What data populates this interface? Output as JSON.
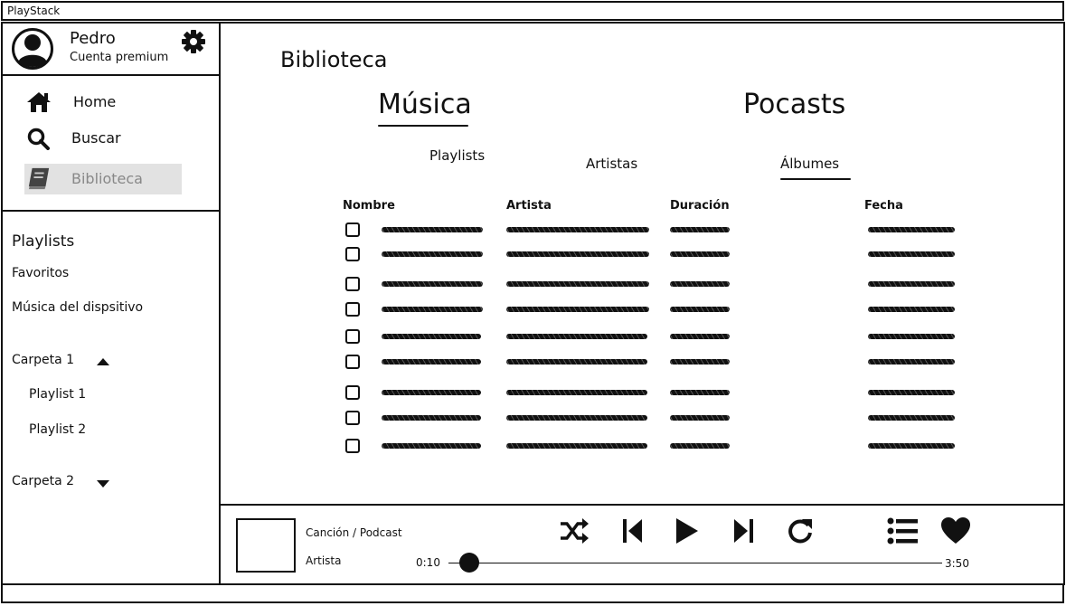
{
  "window": {
    "title": "PlayStack"
  },
  "user": {
    "name": "Pedro",
    "plan": "Cuenta premium"
  },
  "nav": {
    "home": "Home",
    "search": "Buscar",
    "library": "Biblioteca"
  },
  "sidebar": {
    "playlists_title": "Playlists",
    "favorites": "Favoritos",
    "device_music": "Música del dispsitivo",
    "folders": [
      {
        "label": "Carpeta 1",
        "expanded": true,
        "items": [
          "Playlist 1",
          "Playlist 2"
        ]
      },
      {
        "label": "Carpeta 2",
        "expanded": false,
        "items": []
      }
    ]
  },
  "main": {
    "title": "Biblioteca",
    "tabs": [
      "Música",
      "Pocasts"
    ],
    "active_tab": "Música",
    "subtabs": [
      "Playlists",
      "Artistas",
      "Álbumes"
    ],
    "active_subtab": "Álbumes",
    "columns": [
      "Nombre",
      "Artista",
      "Duración",
      "Fecha"
    ],
    "row_count": 9
  },
  "player": {
    "title": "Canción / Podcast",
    "artist": "Artista",
    "elapsed": "0:10",
    "total": "3:50",
    "progress": 0.043,
    "controls": [
      "shuffle-icon",
      "skip-previous-icon",
      "play-icon",
      "skip-next-icon",
      "repeat-icon",
      "queue-icon",
      "heart-icon"
    ]
  }
}
